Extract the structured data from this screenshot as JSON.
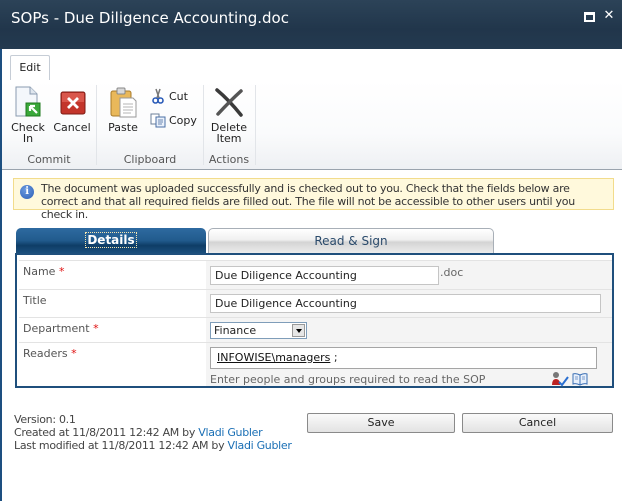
{
  "window": {
    "title": "SOPs - Due Diligence Accounting.doc",
    "maximize_icon": "maximize-icon",
    "close_icon": "close-icon"
  },
  "ribbon": {
    "tab": "Edit",
    "groups": [
      {
        "label": "Commit",
        "buttons": [
          {
            "label_line1": "Check",
            "label_line2": "In",
            "icon": "check-in-icon"
          },
          {
            "label_line1": "Cancel",
            "label_line2": "",
            "icon": "cancel-icon"
          }
        ]
      },
      {
        "label": "Clipboard",
        "buttons": [
          {
            "label_line1": "Paste",
            "icon": "paste-icon"
          },
          {
            "label_line1": "Cut",
            "icon": "cut-icon"
          },
          {
            "label_line1": "Copy",
            "icon": "copy-icon"
          }
        ]
      },
      {
        "label": "Actions",
        "buttons": [
          {
            "label_line1": "Delete",
            "label_line2": "Item",
            "icon": "delete-icon"
          }
        ]
      }
    ]
  },
  "info": {
    "icon": "info-icon",
    "message": "The document was uploaded successfully and is checked out to you. Check that the fields below are correct and that all required fields are filled out. The file will not be accessible to other users until you check in."
  },
  "form_tabs": [
    {
      "label": "Details",
      "active": true
    },
    {
      "label": "Read & Sign",
      "active": false
    }
  ],
  "fields": {
    "name": {
      "label": "Name",
      "required_marker": "*",
      "value": "Due Diligence Accounting",
      "extension": ".doc"
    },
    "title": {
      "label": "Title",
      "value": "Due Diligence Accounting"
    },
    "department": {
      "label": "Department",
      "required_marker": "*",
      "selected": "Finance"
    },
    "readers": {
      "label": "Readers",
      "required_marker": "*",
      "value_entity": "INFOWISE\\managers",
      "value_suffix": " ;",
      "hint": "Enter people and groups required to read the SOP",
      "check_names_icon": "check-names-icon",
      "browse_icon": "address-book-icon"
    }
  },
  "footer": {
    "version": "Version: 0.1",
    "created_prefix": "Created at 11/8/2011 12:42 AM by ",
    "created_by": "Vladi Gubler",
    "modified_prefix": "Last modified at 11/8/2011 12:42 AM by ",
    "modified_by": "Vladi Gubler",
    "save_label": "Save",
    "cancel_label": "Cancel"
  },
  "colors": {
    "title_bar": "#21364b",
    "accent_blue": "#1f4f7c",
    "link": "#1a6fb5",
    "required": "#e01010",
    "info_bg": "#fff9dc"
  }
}
